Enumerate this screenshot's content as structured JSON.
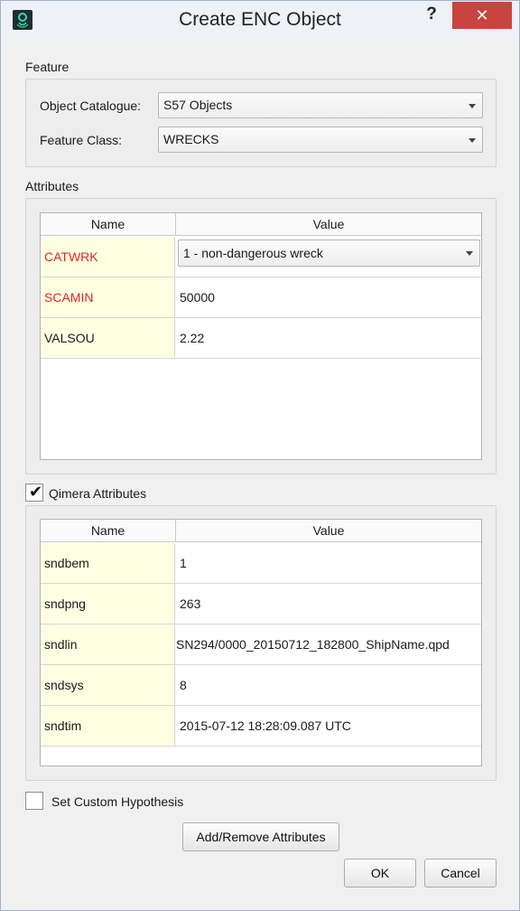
{
  "window": {
    "title": "Create ENC Object",
    "help_label": "?",
    "close_label": "✕"
  },
  "feature": {
    "section_label": "Feature",
    "object_catalogue_label": "Object Catalogue:",
    "object_catalogue_value": "S57 Objects",
    "feature_class_label": "Feature Class:",
    "feature_class_value": "WRECKS"
  },
  "attributes": {
    "section_label": "Attributes",
    "columns": [
      "Name",
      "Value"
    ],
    "rows": [
      {
        "name": "CATWRK",
        "value": "1 - non-dangerous wreck",
        "mandatory": true,
        "editor": "dropdown"
      },
      {
        "name": "SCAMIN",
        "value": "50000",
        "mandatory": true
      },
      {
        "name": "VALSOU",
        "value": "2.22",
        "mandatory": false
      }
    ]
  },
  "qimera": {
    "checkbox_label": "Qimera Attributes",
    "checked": true,
    "columns": [
      "Name",
      "Value"
    ],
    "rows": [
      {
        "name": "sndbem",
        "value": "1"
      },
      {
        "name": "sndpng",
        "value": "263"
      },
      {
        "name": "sndlin",
        "value": "SN294/0000_20150712_182800_ShipName.qpd"
      },
      {
        "name": "sndsys",
        "value": "8"
      },
      {
        "name": "sndtim",
        "value": "2015-07-12 18:28:09.087 UTC"
      }
    ]
  },
  "custom_hypothesis": {
    "label": "Set Custom Hypothesis",
    "checked": false
  },
  "buttons": {
    "add_remove": "Add/Remove Attributes",
    "ok": "OK",
    "cancel": "Cancel"
  },
  "colors": {
    "mandatory_text": "#e0261f",
    "name_cell_bg": "#ffffe3",
    "close_button": "#c74440"
  },
  "icons": [
    "app-icon",
    "help-icon",
    "close-icon",
    "dropdown-arrow-icon",
    "checkmark-icon"
  ]
}
